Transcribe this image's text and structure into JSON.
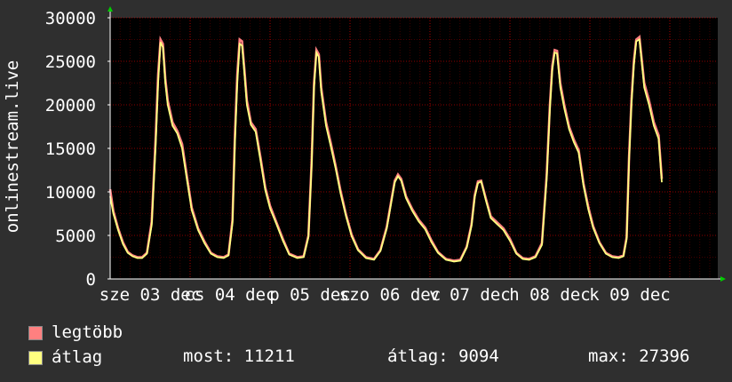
{
  "chart_data": {
    "type": "line",
    "ylabel": "onlinestream.live",
    "ylim": [
      0,
      30000
    ],
    "yticks": [
      0,
      5000,
      10000,
      15000,
      20000,
      25000,
      30000
    ],
    "ytick_labels": [
      "0",
      "5000",
      "10000",
      "15000",
      "20000",
      "25000",
      "30000"
    ],
    "xlim": [
      0,
      7.6
    ],
    "xticks": [
      {
        "x": 0.5,
        "label": "sze 03 dec"
      },
      {
        "x": 1.5,
        "label": "cs 04 dec"
      },
      {
        "x": 2.5,
        "label": "p 05 dec"
      },
      {
        "x": 3.5,
        "label": "szo 06 dec"
      },
      {
        "x": 4.5,
        "label": "v 07 dec"
      },
      {
        "x": 5.5,
        "label": "h 08 dec"
      },
      {
        "x": 6.5,
        "label": "k 09 dec"
      }
    ],
    "grid": true,
    "colors": {
      "max": "#ff8080",
      "avg": "#ffff80",
      "grid": "#ff0000",
      "background": "#000000",
      "arrow": "#00cc00"
    },
    "series": [
      {
        "name": "legtöbb",
        "color": "#ff8080",
        "x": [
          0,
          0.04,
          0.1,
          0.16,
          0.22,
          0.28,
          0.34,
          0.4,
          0.46,
          0.52,
          0.57,
          0.6,
          0.63,
          0.66,
          0.69,
          0.72,
          0.78,
          0.84,
          0.9,
          0.96,
          1.02,
          1.1,
          1.18,
          1.26,
          1.34,
          1.42,
          1.48,
          1.53,
          1.56,
          1.59,
          1.62,
          1.65,
          1.68,
          1.71,
          1.76,
          1.82,
          1.88,
          1.94,
          2.0,
          2.08,
          2.16,
          2.24,
          2.34,
          2.42,
          2.48,
          2.52,
          2.55,
          2.58,
          2.61,
          2.64,
          2.7,
          2.76,
          2.82,
          2.88,
          2.95,
          3.02,
          3.1,
          3.2,
          3.3,
          3.38,
          3.46,
          3.52,
          3.56,
          3.6,
          3.64,
          3.7,
          3.78,
          3.86,
          3.94,
          4.02,
          4.1,
          4.2,
          4.3,
          4.38,
          4.46,
          4.52,
          4.56,
          4.6,
          4.64,
          4.7,
          4.76,
          4.84,
          4.92,
          5.0,
          5.08,
          5.16,
          5.24,
          5.32,
          5.4,
          5.46,
          5.5,
          5.53,
          5.56,
          5.59,
          5.63,
          5.68,
          5.74,
          5.8,
          5.86,
          5.92,
          5.98,
          6.04,
          6.12,
          6.2,
          6.28,
          6.36,
          6.42,
          6.46,
          6.49,
          6.52,
          6.55,
          6.58,
          6.62,
          6.68,
          6.74,
          6.8,
          6.86,
          6.9
        ],
        "values": [
          10300,
          7800,
          5800,
          4200,
          3100,
          2700,
          2500,
          2500,
          3000,
          6600,
          16500,
          23500,
          27500,
          27000,
          23000,
          20500,
          18000,
          17000,
          15500,
          11800,
          8200,
          5800,
          4300,
          3000,
          2600,
          2500,
          2800,
          6800,
          16500,
          23500,
          27500,
          27300,
          24000,
          20500,
          18000,
          17200,
          14000,
          10500,
          8400,
          6500,
          4600,
          2900,
          2500,
          2600,
          5000,
          13500,
          22500,
          26300,
          25800,
          22000,
          18000,
          15600,
          13000,
          10200,
          7400,
          5100,
          3400,
          2500,
          2300,
          3300,
          6000,
          9200,
          11300,
          12000,
          11500,
          9500,
          8000,
          6800,
          5900,
          4400,
          3100,
          2300,
          2100,
          2200,
          3700,
          6300,
          9600,
          11200,
          11300,
          9200,
          7200,
          6500,
          5800,
          4600,
          3000,
          2400,
          2300,
          2600,
          4100,
          12000,
          20000,
          24500,
          26300,
          26200,
          22500,
          20000,
          17500,
          16000,
          14800,
          11000,
          8300,
          6100,
          4200,
          3000,
          2600,
          2500,
          2700,
          4800,
          14000,
          20500,
          25000,
          27500,
          27800,
          22500,
          20500,
          18000,
          16500,
          11500
        ]
      },
      {
        "name": "átlag",
        "color": "#ffff80",
        "x": [
          0,
          0.04,
          0.1,
          0.16,
          0.22,
          0.28,
          0.34,
          0.4,
          0.46,
          0.52,
          0.57,
          0.6,
          0.63,
          0.66,
          0.69,
          0.72,
          0.78,
          0.84,
          0.9,
          0.96,
          1.02,
          1.1,
          1.18,
          1.26,
          1.34,
          1.42,
          1.48,
          1.53,
          1.56,
          1.59,
          1.62,
          1.65,
          1.68,
          1.71,
          1.76,
          1.82,
          1.88,
          1.94,
          2.0,
          2.08,
          2.16,
          2.24,
          2.34,
          2.42,
          2.48,
          2.52,
          2.55,
          2.58,
          2.61,
          2.64,
          2.7,
          2.76,
          2.82,
          2.88,
          2.95,
          3.02,
          3.1,
          3.2,
          3.3,
          3.38,
          3.46,
          3.52,
          3.56,
          3.6,
          3.64,
          3.7,
          3.78,
          3.86,
          3.94,
          4.02,
          4.1,
          4.2,
          4.3,
          4.38,
          4.46,
          4.52,
          4.56,
          4.6,
          4.64,
          4.7,
          4.76,
          4.84,
          4.92,
          5.0,
          5.08,
          5.16,
          5.24,
          5.32,
          5.4,
          5.46,
          5.5,
          5.53,
          5.56,
          5.59,
          5.63,
          5.68,
          5.74,
          5.8,
          5.86,
          5.92,
          5.98,
          6.04,
          6.12,
          6.2,
          6.28,
          6.36,
          6.42,
          6.46,
          6.49,
          6.52,
          6.55,
          6.58,
          6.62,
          6.68,
          6.74,
          6.8,
          6.86,
          6.9
        ],
        "values": [
          9500,
          7500,
          5600,
          4000,
          3000,
          2600,
          2400,
          2400,
          2900,
          6200,
          15500,
          22500,
          27200,
          26600,
          22500,
          20000,
          17600,
          16700,
          15000,
          11400,
          7900,
          5600,
          4100,
          2900,
          2500,
          2400,
          2700,
          6400,
          15500,
          22500,
          27000,
          26800,
          23500,
          20000,
          17700,
          16900,
          13600,
          10200,
          8100,
          6300,
          4400,
          2800,
          2400,
          2500,
          4800,
          13000,
          22000,
          26000,
          25500,
          21500,
          17600,
          15200,
          12700,
          9900,
          7200,
          4900,
          3300,
          2400,
          2200,
          3200,
          5800,
          9000,
          11100,
          11800,
          11300,
          9300,
          7800,
          6600,
          5700,
          4200,
          3000,
          2200,
          2000,
          2100,
          3600,
          6100,
          9400,
          11000,
          11200,
          9000,
          7000,
          6300,
          5600,
          4400,
          2900,
          2300,
          2200,
          2500,
          3900,
          11500,
          19500,
          24000,
          26000,
          25900,
          22000,
          19600,
          17200,
          15700,
          14500,
          10700,
          8000,
          5900,
          4100,
          2900,
          2500,
          2400,
          2600,
          4600,
          13500,
          20000,
          24500,
          27300,
          27500,
          22000,
          20000,
          17600,
          16100,
          11100
        ]
      }
    ]
  },
  "legend": [
    {
      "label": "legtöbb",
      "color": "#ff8080"
    },
    {
      "label": "átlag",
      "color": "#ffff80"
    }
  ],
  "stats": {
    "current": "most: 11211",
    "average": "átlag: 9094",
    "max": "max: 27396"
  }
}
